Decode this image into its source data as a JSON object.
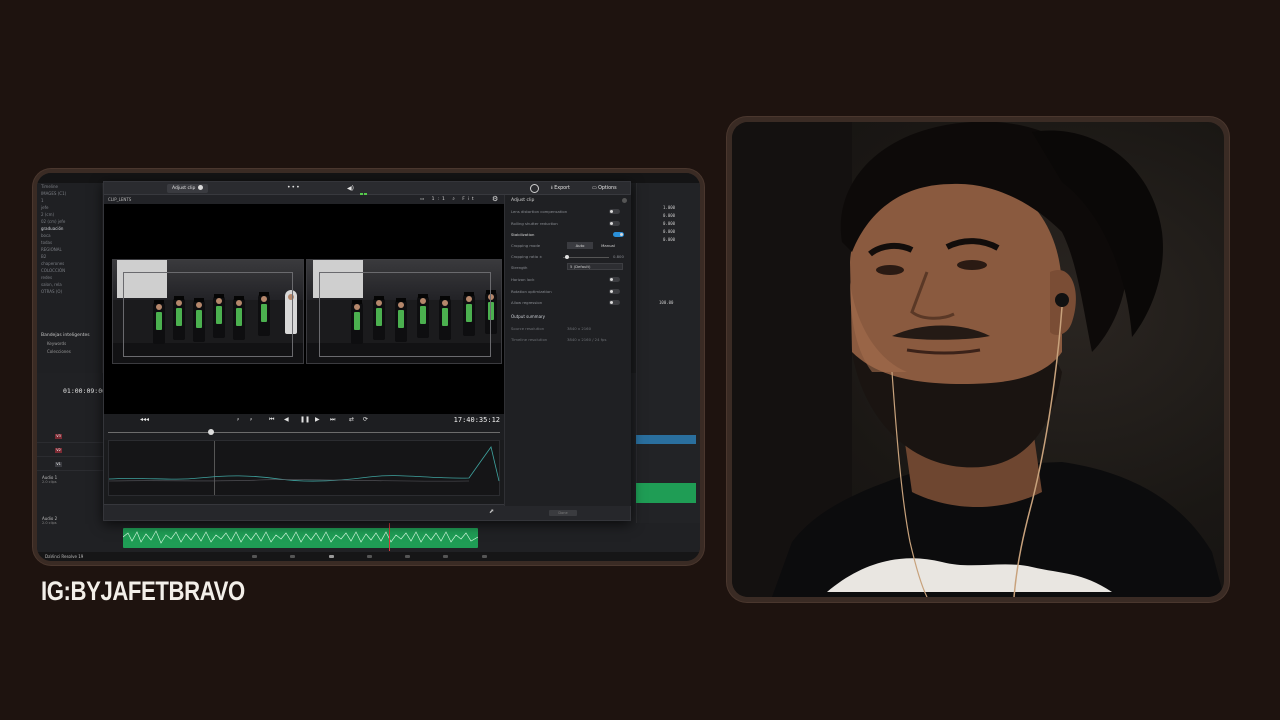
{
  "overlay": {
    "handle": "IG:BYJAFETBRAVO"
  },
  "resolve": {
    "media_pool_items": [
      "Timeline",
      "IMAGES (C1)",
      "1",
      "jefe",
      "2 (cm)",
      "02 (cm) jefe",
      "graduación",
      "boca",
      "todas",
      "REGIONAL",
      "B2",
      "chaperones",
      "COLOCCIÓN",
      "redes",
      "salon, rela",
      "OTRAS (O)"
    ],
    "bins_label": "Bandejas inteligentes",
    "bins_keywords": "Keywords",
    "bins_collections": "Colecciones",
    "timeline_timecode": "01:00:09:06",
    "tracks": [
      "V3",
      "V2",
      "V1"
    ],
    "audio_tracks": [
      {
        "name": "Audio 1",
        "sub": "2.0 clips"
      },
      {
        "name": "Audio 2",
        "sub": "2.0 clips"
      }
    ],
    "right_values": [
      "1.000",
      "0.000",
      "0.000",
      "0.000",
      "0.000",
      "100.00"
    ],
    "bottom_label": "DaVinci Resolve 19",
    "colors": {
      "audio_clip": "#1f9d55",
      "video_clip": "#2a6f9e",
      "accent": "#2a8fd8"
    }
  },
  "dialog": {
    "tab_label": "Adjust clip",
    "dots": "•••",
    "export_label": "Export",
    "options_label": "Options",
    "viewer_label": "CLIP_LENTS",
    "viewer_tools": "▭ 1:1 ⌕ Fit",
    "playback_timecode": "17:40:35:12",
    "done_label": "Done",
    "inspector": {
      "title": "Adjust clip",
      "rows": [
        {
          "label": "Lens distortion compensation",
          "control": "toggle",
          "on": false
        },
        {
          "label": "Rolling shutter reduction",
          "control": "toggle",
          "on": false
        },
        {
          "label": "Stabilization",
          "control": "toggle",
          "on": true
        },
        {
          "label": "Cropping mode",
          "control": "segment",
          "options": [
            "Auto",
            "Manual"
          ]
        },
        {
          "label": "Cropping ratio ±",
          "control": "slider",
          "value": "0.800"
        },
        {
          "label": "Strength",
          "control": "dropdown",
          "value": "5 (Default)"
        },
        {
          "label": "Horizon lock",
          "control": "toggle",
          "on": false
        },
        {
          "label": "Rotation optimization",
          "control": "toggle",
          "on": false
        },
        {
          "label": "Allow regression",
          "control": "toggle",
          "on": false
        }
      ],
      "summary_title": "Output summary",
      "summary_rows": [
        {
          "label": "Source resolution",
          "value": "3840 x 2160"
        },
        {
          "label": "Timeline resolution",
          "value": "3840 x 2160 / 24 fps"
        }
      ]
    }
  }
}
